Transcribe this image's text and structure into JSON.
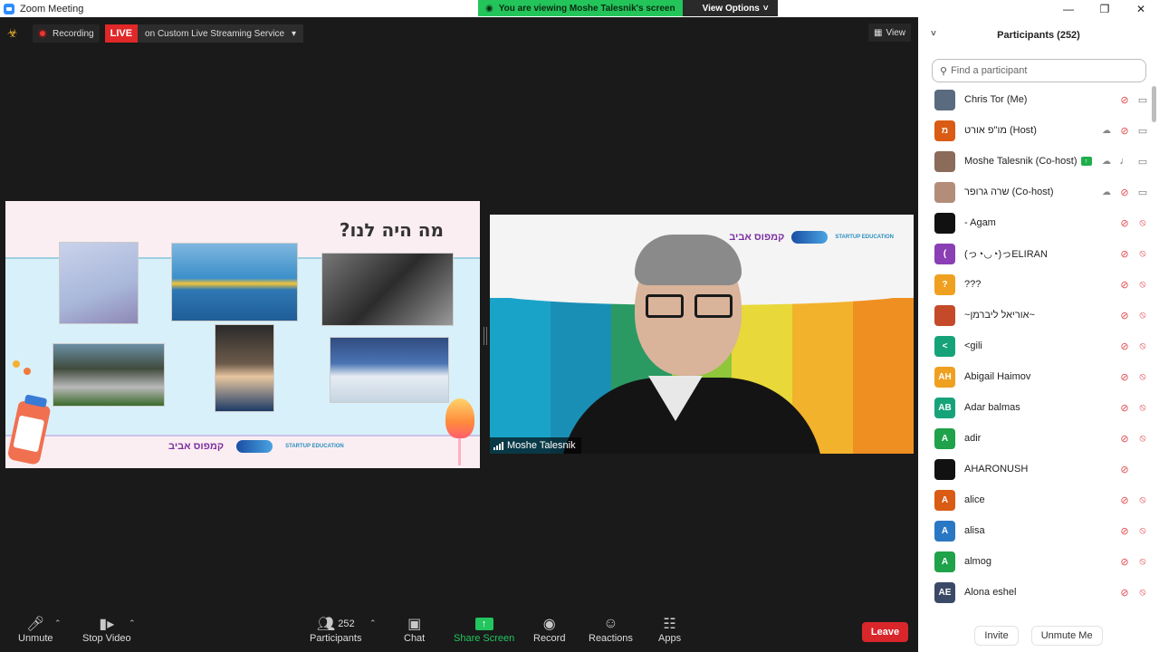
{
  "window": {
    "title": "Zoom Meeting"
  },
  "banner": {
    "viewing": "You are viewing Moshe Talesnik's screen",
    "view_options": "View Options"
  },
  "meeting": {
    "recording": "Recording",
    "live": "LIVE",
    "stream": "on Custom Live Streaming Service",
    "view": "View"
  },
  "slide": {
    "title": "מה היה לנו?",
    "logo_text": "קמפוס אביב",
    "logo_small": "STARTUP EDUCATION"
  },
  "video": {
    "name": "Moshe Talesnik",
    "logo_text": "קמפוס אביב",
    "logo_small": "STARTUP EDUCATION"
  },
  "toolbar": {
    "unmute": "Unmute",
    "stop_video": "Stop Video",
    "participants": "Participants",
    "participants_count": "252",
    "chat": "Chat",
    "share": "Share Screen",
    "record": "Record",
    "reactions": "Reactions",
    "apps": "Apps",
    "leave": "Leave"
  },
  "panel": {
    "title": "Participants (252)",
    "search_placeholder": "Find a participant",
    "invite": "Invite",
    "unmute_me": "Unmute Me",
    "participants": [
      {
        "name": "Chris Tor (Me)",
        "initials": "",
        "color": "#5a6b80",
        "rec": false,
        "mic": "off",
        "video": "on"
      },
      {
        "name": "מו\"פ אורט (Host)",
        "initials": "מ",
        "color": "#d95b14",
        "rec": true,
        "mic": "off",
        "video": "on"
      },
      {
        "name": "Moshe Talesnik (Co-host)",
        "initials": "",
        "color": "#8b6b5a",
        "rec": true,
        "mic": "on",
        "video": "on",
        "share": true
      },
      {
        "name": "שרה גרופר (Co-host)",
        "initials": "",
        "color": "#b38d7a",
        "rec": true,
        "mic": "off",
        "video": "on"
      },
      {
        "name": "- Agam",
        "initials": "",
        "color": "#111111",
        "rec": false,
        "mic": "off",
        "video": "off"
      },
      {
        "name": "(っ◔◡◔)っELIRAN",
        "initials": "(",
        "color": "#8a3fb5",
        "rec": false,
        "mic": "off",
        "video": "off"
      },
      {
        "name": "???",
        "initials": "?",
        "color": "#f0a020",
        "rec": false,
        "mic": "off",
        "video": "off"
      },
      {
        "name": "~אוריאל ליברמן~",
        "initials": "",
        "color": "#c44a2a",
        "rec": false,
        "mic": "off",
        "video": "off"
      },
      {
        "name": "<gili",
        "initials": "<",
        "color": "#16a37a",
        "rec": false,
        "mic": "off",
        "video": "off"
      },
      {
        "name": "Abigail Haimov",
        "initials": "AH",
        "color": "#f0a020",
        "rec": false,
        "mic": "off",
        "video": "off"
      },
      {
        "name": "Adar balmas",
        "initials": "AB",
        "color": "#16a37a",
        "rec": false,
        "mic": "off",
        "video": "off"
      },
      {
        "name": "adir",
        "initials": "A",
        "color": "#1fa24a",
        "rec": false,
        "mic": "off",
        "video": "off"
      },
      {
        "name": "AHARONUSH",
        "initials": "",
        "color": "#111111",
        "rec": false,
        "mic": "off",
        "video": "none"
      },
      {
        "name": "alice",
        "initials": "A",
        "color": "#d95b14",
        "rec": false,
        "mic": "off",
        "video": "off"
      },
      {
        "name": "alisa",
        "initials": "A",
        "color": "#2a78c4",
        "rec": false,
        "mic": "off",
        "video": "off"
      },
      {
        "name": "almog",
        "initials": "A",
        "color": "#1fa24a",
        "rec": false,
        "mic": "off",
        "video": "off"
      },
      {
        "name": "Alona eshel",
        "initials": "AE",
        "color": "#3a4a66",
        "rec": false,
        "mic": "off",
        "video": "off"
      }
    ]
  },
  "colors": {
    "live": "#e02828",
    "share": "#22c55e",
    "leave": "#d9262b",
    "mic_off": "#e0464b"
  }
}
